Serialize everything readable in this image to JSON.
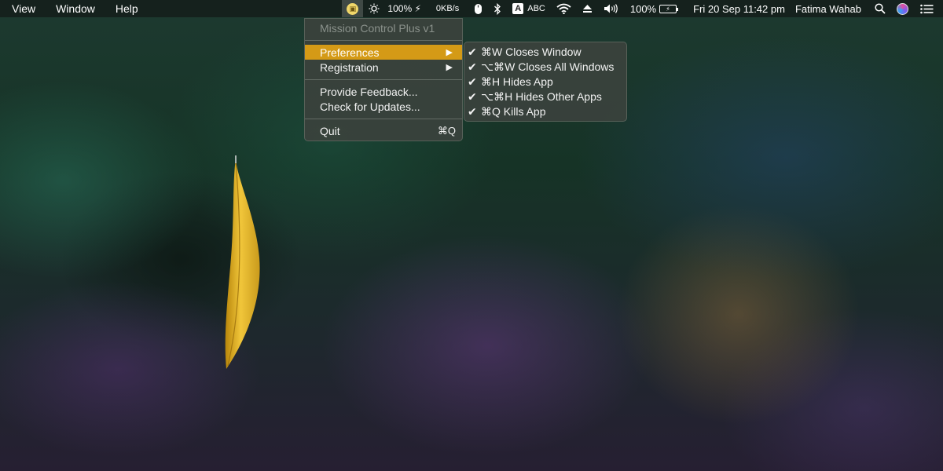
{
  "menubar": {
    "left_items": [
      "View",
      "Window",
      "Help"
    ],
    "status": {
      "app_icon": "mission-control-plus-icon",
      "brightness_icon": "sun-icon",
      "brightness_value": "100% ⚡",
      "network_speed": "0KB/s",
      "mouse_icon": "mouse-icon",
      "bluetooth_icon": "bluetooth-icon",
      "input_letter": "A",
      "input_source": "ABC",
      "wifi_icon": "wifi-icon",
      "airplay_icon": "airplay-icon",
      "volume_icon": "volume-icon",
      "battery_value": "100%",
      "datetime": "Fri 20 Sep  11:42 pm",
      "user": "Fatima Wahab",
      "search_icon": "spotlight-icon",
      "siri_icon": "siri-icon",
      "notifications_icon": "notification-center-icon"
    }
  },
  "menu": {
    "title": "Mission Control Plus v1",
    "preferences": "Preferences",
    "registration": "Registration",
    "feedback": "Provide Feedback...",
    "updates": "Check for Updates...",
    "quit": "Quit",
    "quit_shortcut": "⌘Q",
    "submenu_arrow": "▶",
    "highlight_color": "#d49a16"
  },
  "submenu": {
    "items": [
      "⌘W Closes Window",
      "⌥⌘W Closes All Windows",
      "⌘H Hides App",
      "⌥⌘H Hides Other Apps",
      "⌘Q Kills App"
    ],
    "check": "✔"
  }
}
